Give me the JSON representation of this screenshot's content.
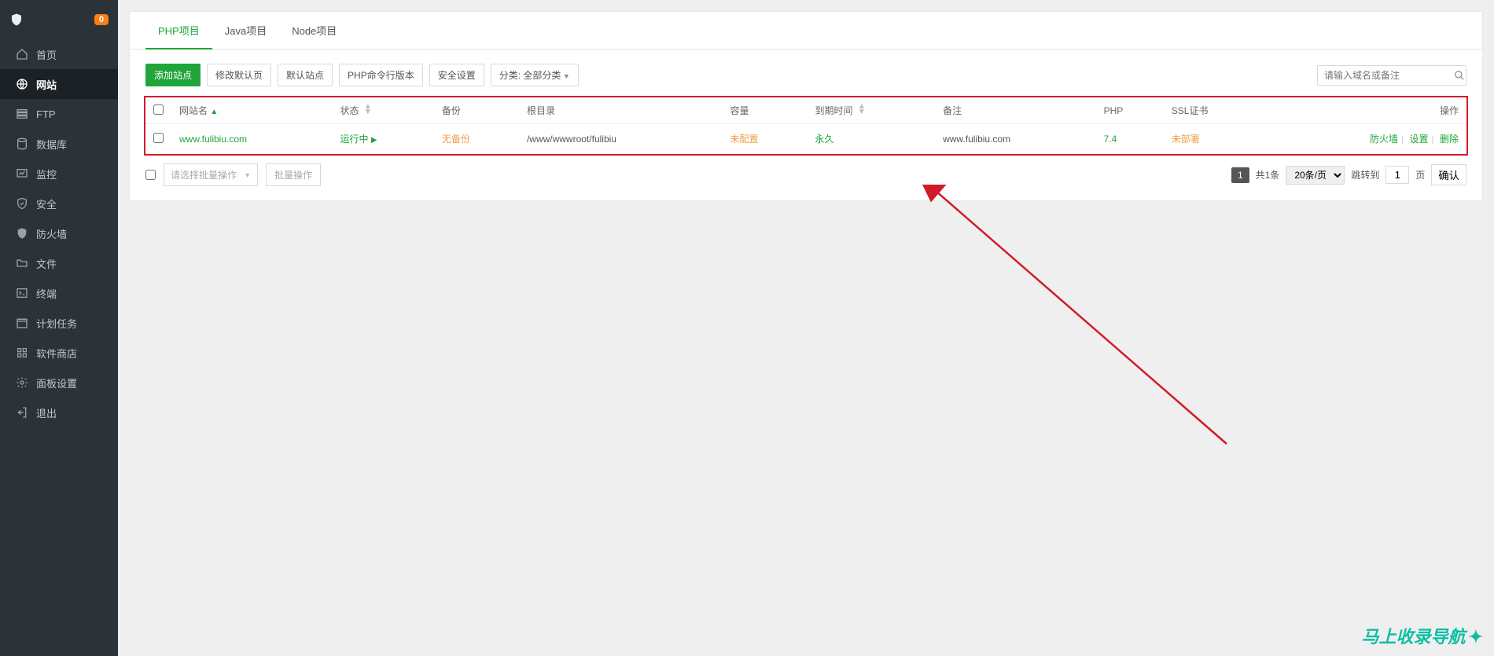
{
  "sidebar": {
    "badge": "0",
    "items": [
      {
        "label": "首页"
      },
      {
        "label": "网站"
      },
      {
        "label": "FTP"
      },
      {
        "label": "数据库"
      },
      {
        "label": "监控"
      },
      {
        "label": "安全"
      },
      {
        "label": "防火墙"
      },
      {
        "label": "文件"
      },
      {
        "label": "终端"
      },
      {
        "label": "计划任务"
      },
      {
        "label": "软件商店"
      },
      {
        "label": "面板设置"
      },
      {
        "label": "退出"
      }
    ]
  },
  "tabs": {
    "php": "PHP项目",
    "java": "Java项目",
    "node": "Node项目"
  },
  "toolbar": {
    "add": "添加站点",
    "modify_default": "修改默认页",
    "default_site": "默认站点",
    "php_cli": "PHP命令行版本",
    "security": "安全设置",
    "category": "分类: 全部分类",
    "search_placeholder": "请输入域名或备注"
  },
  "table": {
    "headers": {
      "name": "网站名",
      "status": "状态",
      "backup": "备份",
      "root": "根目录",
      "quota": "容量",
      "expire": "到期时间",
      "note": "备注",
      "php": "PHP",
      "ssl": "SSL证书",
      "ops": "操作"
    },
    "rows": [
      {
        "name": "www.fulibiu.com",
        "status": "运行中",
        "backup": "无备份",
        "root": "/www/wwwroot/fulibiu",
        "quota": "未配置",
        "expire": "永久",
        "note": "www.fulibiu.com",
        "php": "7.4",
        "ssl": "未部署",
        "op_firewall": "防火墙",
        "op_settings": "设置",
        "op_delete": "删除"
      }
    ]
  },
  "bulk": {
    "placeholder": "请选择批量操作",
    "btn": "批量操作"
  },
  "pagination": {
    "current": "1",
    "total": "共1条",
    "page_size": "20条/页",
    "jump_label": "跳转到",
    "jump_value": "1",
    "page_word": "页",
    "go": "确认"
  },
  "watermark": "马上收录导航"
}
